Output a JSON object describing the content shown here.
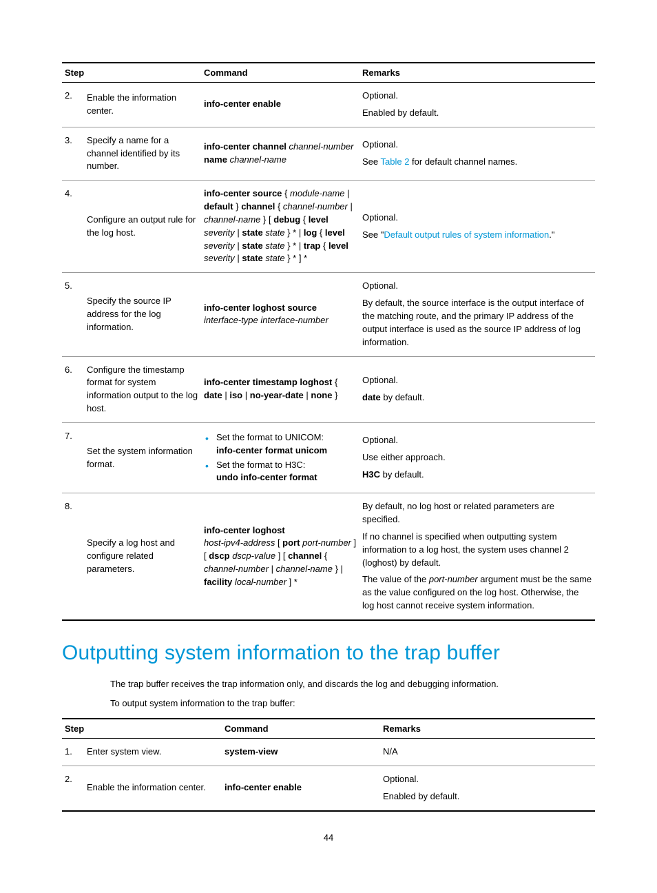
{
  "table1": {
    "headers": {
      "step": "Step",
      "command": "Command",
      "remarks": "Remarks"
    },
    "rows": [
      {
        "num": "2.",
        "desc": "Enable the information center.",
        "cmd_bold": "info-center enable",
        "rem1": "Optional.",
        "rem2": "Enabled by default."
      },
      {
        "num": "3.",
        "desc": "Specify a name for a channel identified by its number.",
        "cmd_b1": "info-center channel",
        "cmd_i1": "channel-number",
        "cmd_b2": "name",
        "cmd_i2": "channel-name",
        "rem1": "Optional.",
        "rem2a": "See ",
        "rem2link": "Table 2",
        "rem2b": " for default channel names."
      },
      {
        "num": "4.",
        "desc": "Configure an output rule for the log host.",
        "s4_b1": "info-center source",
        "s4_t1": " { ",
        "s4_i1": "module-name",
        "s4_t2": " | ",
        "s4_b2": "default",
        "s4_t3": " } ",
        "s4_b3": "channel",
        "s4_t4": " { ",
        "s4_i2": "channel-number",
        "s4_t5": " | ",
        "s4_i3": "channel-name",
        "s4_t6": " } [ ",
        "s4_b4": "debug",
        "s4_t7": " { ",
        "s4_b5": "level",
        "s4_i4": "severity",
        "s4_t8": " | ",
        "s4_b6": "state",
        "s4_i5": "state",
        "s4_t9": " } * | ",
        "s4_b7": "log",
        "s4_t10": " { ",
        "s4_b8": "level",
        "s4_i6": "severity",
        "s4_t11": " | ",
        "s4_b9": "state",
        "s4_i7": "state",
        "s4_t12": " } * | ",
        "s4_b10": "trap",
        "s4_t13": " { ",
        "s4_b11": "level",
        "s4_i8": "severity",
        "s4_t14": " | ",
        "s4_b12": "state",
        "s4_i9": "state",
        "s4_t15": " } * ] *",
        "rem1": "Optional.",
        "rem2a": "See \"",
        "rem2link": "Default output rules of system information",
        "rem2b": ".\""
      },
      {
        "num": "5.",
        "desc": "Specify the source IP address for the log information.",
        "s5_b1": "info-center loghost source",
        "s5_i1": "interface-type interface-number",
        "rem1": "Optional.",
        "rem2": "By default, the source interface is the output interface of the matching route, and the primary IP address of the output interface is used as the source IP address of log information."
      },
      {
        "num": "6.",
        "desc": "Configure the timestamp format for system information output to the log host.",
        "s6_b1": "info-center timestamp loghost",
        "s6_t1": " { ",
        "s6_b2": "date",
        "s6_t2": " | ",
        "s6_b3": "iso",
        "s6_t3": " | ",
        "s6_b4": "no-year-date",
        "s6_t4": " | ",
        "s6_b5": "none",
        "s6_t5": " }",
        "rem1": "Optional.",
        "rem2a": "date",
        "rem2b": " by default."
      },
      {
        "num": "7.",
        "desc": "Set the system information format.",
        "li1": "Set the format to UNICOM:",
        "li1b": "info-center format unicom",
        "li2": "Set the format to H3C:",
        "li2b": "undo info-center format",
        "rem1": "Optional.",
        "rem2": "Use either approach.",
        "rem3a": "H3C",
        "rem3b": " by default."
      },
      {
        "num": "8.",
        "desc": "Specify a log host and configure related parameters.",
        "s8_b1": "info-center loghost",
        "s8_i1": "host-ipv4-address",
        "s8_t1": " [ ",
        "s8_b2": "port",
        "s8_i2": "port-number",
        "s8_t2": " ] [ ",
        "s8_b3": "dscp",
        "s8_i3": "dscp-value",
        "s8_t3": " ] [ ",
        "s8_b4": "channel",
        "s8_t4": " { ",
        "s8_i4": "channel-number",
        "s8_t5": " | ",
        "s8_i5": "channel-name",
        "s8_t6": " } | ",
        "s8_b5": "facility",
        "s8_i6": "local-number",
        "s8_t7": " ] *",
        "rem1": "By default, no log host or related parameters are specified.",
        "rem2": "If no channel is specified when outputting system information to a log host, the system uses channel 2 (loghost) by default.",
        "rem3a": "The value of the ",
        "rem3i": "port-number",
        "rem3b": " argument must be the same as the value configured on the log host. Otherwise, the log host cannot receive system information."
      }
    ]
  },
  "section_heading": "Outputting system information to the trap buffer",
  "para1": "The trap buffer receives the trap information only, and discards the log and debugging information.",
  "para2": "To output system information to the trap buffer:",
  "table2": {
    "headers": {
      "step": "Step",
      "command": "Command",
      "remarks": "Remarks"
    },
    "rows": [
      {
        "num": "1.",
        "desc": "Enter system view.",
        "cmd": "system-view",
        "rem": "N/A"
      },
      {
        "num": "2.",
        "desc": "Enable the information center.",
        "cmd": "info-center enable",
        "rem1": "Optional.",
        "rem2": "Enabled by default."
      }
    ]
  },
  "page_number": "44"
}
